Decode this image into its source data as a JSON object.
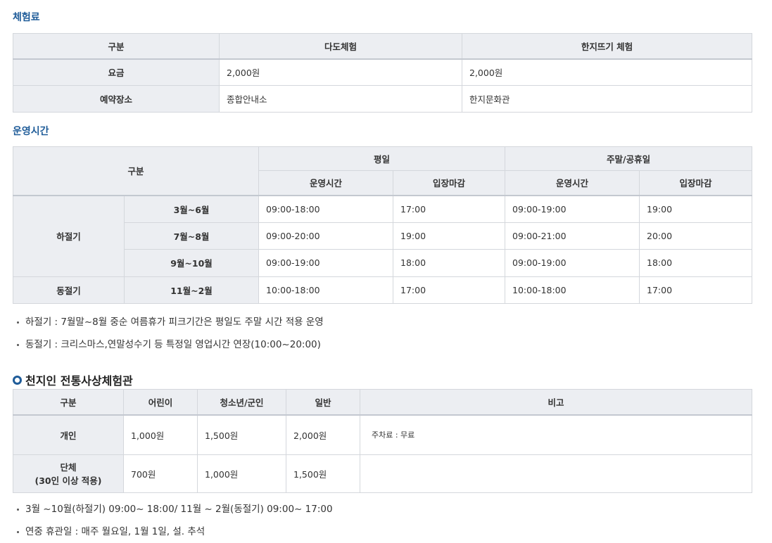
{
  "fee_section": {
    "title": "체험료",
    "header": [
      "구분",
      "다도체험",
      "한지뜨기 체험"
    ],
    "rows": [
      {
        "label": "요금",
        "cells": [
          "2,000원",
          "2,000원"
        ]
      },
      {
        "label": "예약장소",
        "cells": [
          "종합안내소",
          "한지문화관"
        ]
      }
    ]
  },
  "hours_section": {
    "title": "운영시간",
    "header": {
      "category": "구분",
      "weekday": "평일",
      "weekend": "주말/공휴일",
      "open_hours": "운영시간",
      "last_entry": "입장마감"
    },
    "summer_label": "하절기",
    "winter_label": "동절기",
    "rows": [
      {
        "period": "3월~6월",
        "values": [
          "09:00-18:00",
          "17:00",
          "09:00-19:00",
          "19:00"
        ]
      },
      {
        "period": "7월~8월",
        "values": [
          "09:00-20:00",
          "19:00",
          "09:00-21:00",
          "20:00"
        ]
      },
      {
        "period": "9월~10월",
        "values": [
          "09:00-19:00",
          "18:00",
          "09:00-19:00",
          "18:00"
        ]
      },
      {
        "period": "11월~2월",
        "values": [
          "10:00-18:00",
          "17:00",
          "10:00-18:00",
          "17:00"
        ]
      }
    ],
    "notes": [
      "하절기 : 7월말~8월 중순 여름휴가 피크기간은 평일도 주말 시간 적용 운영",
      "동절기 : 크리스마스,연말성수기 등 특정일 영업시간 연장(10:00~20:00)"
    ]
  },
  "cheonjiin_section": {
    "title": "천지인 전통사상체험관",
    "header": [
      "구분",
      "어린이",
      "청소년/군인",
      "일반",
      "비고"
    ],
    "rows": [
      {
        "label": "개인",
        "cells": [
          "1,000원",
          "1,500원",
          "2,000원"
        ],
        "note": "주차료 : 무료"
      },
      {
        "label_line1": "단체",
        "label_line2": "(30인 이상 적용)",
        "cells": [
          "700원",
          "1,000원",
          "1,500원"
        ],
        "note": ""
      }
    ],
    "notes": [
      "3월 ~10월(하절기) 09:00~ 18:00/ 11월 ~ 2월(동절기) 09:00~ 17:00",
      "연중 휴관일 : 매주 월요일, 1월 1일, 설. 추석"
    ]
  },
  "colors": {
    "accent": "#1f5c99",
    "header_bg": "#eceef2",
    "border": "#d4d7dc"
  }
}
